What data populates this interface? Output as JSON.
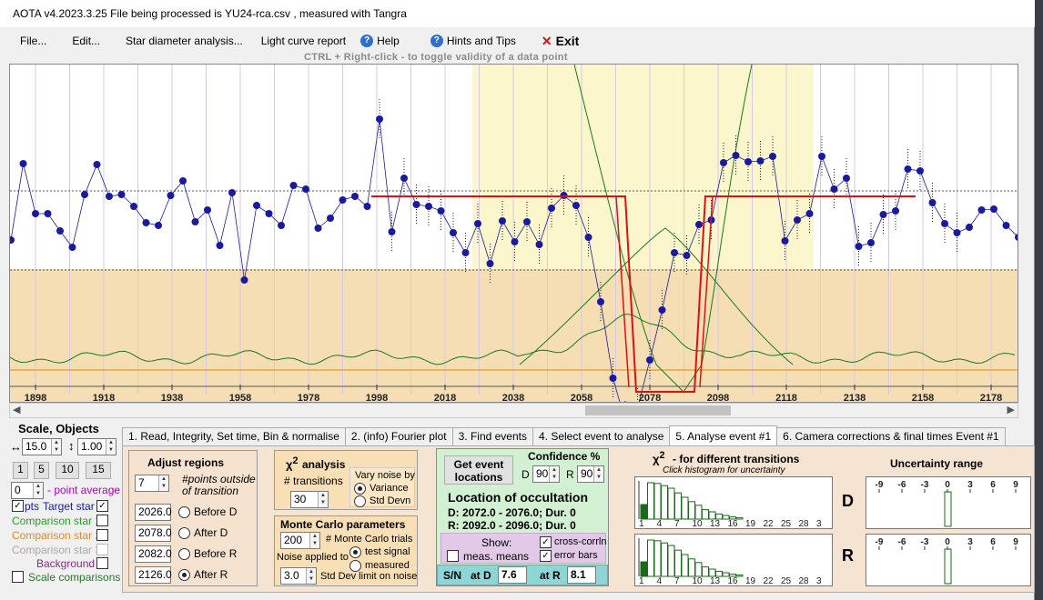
{
  "title": "AOTA v4.2023.3.25   File being processed is  YU24-rca.csv ,  measured with Tangra",
  "menu": {
    "file": "File...",
    "edit": "Edit...",
    "star_diameter": "Star diameter analysis...",
    "light_curve": "Light curve report",
    "help": "Help",
    "hints": "Hints and Tips",
    "exit": "Exit"
  },
  "hint_text": "CTRL + Right-click   -   to toggle validity of a data point",
  "plot": {
    "x_ticks": [
      "1898",
      "1918",
      "1938",
      "1958",
      "1978",
      "1998",
      "2018",
      "2038",
      "2058",
      "2078",
      "2098",
      "2118",
      "2138",
      "2158",
      "2178"
    ],
    "colors": {
      "target": "#1a1aa0",
      "model": "#e01010",
      "comparison": "#1a7a1a",
      "background": "#f5deb3",
      "highlight": "#fbf6cc"
    }
  },
  "left_panel": {
    "scale_objects": "Scale, Objects",
    "scale_x": "15.0",
    "scale_y": "1.00",
    "avg_buttons": [
      "1",
      "5",
      "10",
      "15"
    ],
    "point_avg_value": "0",
    "point_avg_label": "- point average",
    "pts": "pts",
    "target_star": "Target star",
    "comparison_1": "Comparison star 1",
    "comparison_2": "Comparison star 2",
    "comparison_3": "Comparison star 3",
    "background": "Background",
    "scale_comparisons": "Scale comparisons"
  },
  "tabs": [
    "1. Read, Integrity, Set time, Bin & normalise",
    "2. (info) Fourier plot",
    "3. Find events",
    "4. Select event to analyse",
    "5. Analyse event #1",
    "6. Camera corrections & final times Event #1"
  ],
  "adjust": {
    "title": "Adjust regions",
    "points_value": "7",
    "points_label1": "#points outside",
    "points_label2": "of transition",
    "regions": [
      {
        "value": "2026.0",
        "label": "Before D",
        "selected": false
      },
      {
        "value": "2078.0",
        "label": "After D",
        "selected": false
      },
      {
        "value": "2082.0",
        "label": "Before R",
        "selected": false
      },
      {
        "value": "2126.0",
        "label": "After R",
        "selected": true
      }
    ]
  },
  "chi": {
    "title": "analysis",
    "transitions_label": "# transitions",
    "transitions_value": "30",
    "vary_label1": "Vary noise by",
    "vary_opt1": "Variance",
    "vary_opt2": "Std Devn"
  },
  "monte": {
    "title": "Monte Carlo parameters",
    "trials_value": "200",
    "trials_label": "# Monte Carlo trials",
    "noise_label": "Noise applied to",
    "opt_test": "test signal",
    "opt_measured": "measured",
    "std_value": "3.0",
    "std_label": "Std Dev limit on noise"
  },
  "event": {
    "get_locations1": "Get event",
    "get_locations2": "locations",
    "confidence": "Confidence %",
    "d_label": "D",
    "d_value": "90",
    "r_label": "R",
    "r_value": "90",
    "location_title": "Location of occultation",
    "d_line": "D: 2072.0 - 2076.0; Dur. 0",
    "r_line": "R: 2092.0 - 2096.0; Dur. 0",
    "show": "Show:",
    "meas_means": "meas. means",
    "cross_corr": "cross-corrln",
    "error_bars": "error bars",
    "sn": "S/N",
    "at_d": "at D",
    "sn_d": "7.6",
    "at_r": "at R",
    "sn_r": "8.1"
  },
  "chi_hist": {
    "title": "- for different transitions",
    "subtitle": "Click histogram for uncertainty",
    "ticks": [
      "1",
      "4",
      "7",
      "10",
      "13",
      "16",
      "19",
      "22",
      "25",
      "28",
      "3"
    ],
    "bars_d": [
      0.4,
      1.0,
      0.98,
      0.92,
      0.85,
      0.72,
      0.6,
      0.48,
      0.38,
      0.26,
      0.2,
      0.14,
      0.1,
      0.06,
      0.04
    ],
    "bars_r": [
      0.4,
      1.0,
      0.98,
      0.92,
      0.85,
      0.72,
      0.6,
      0.48,
      0.38,
      0.26,
      0.2,
      0.14,
      0.1,
      0.06,
      0.04
    ],
    "d_label": "D",
    "r_label": "R"
  },
  "uncertainty": {
    "title": "Uncertainty range",
    "ticks": [
      "-9",
      "-6",
      "-3",
      "0",
      "3",
      "6",
      "9"
    ]
  }
}
